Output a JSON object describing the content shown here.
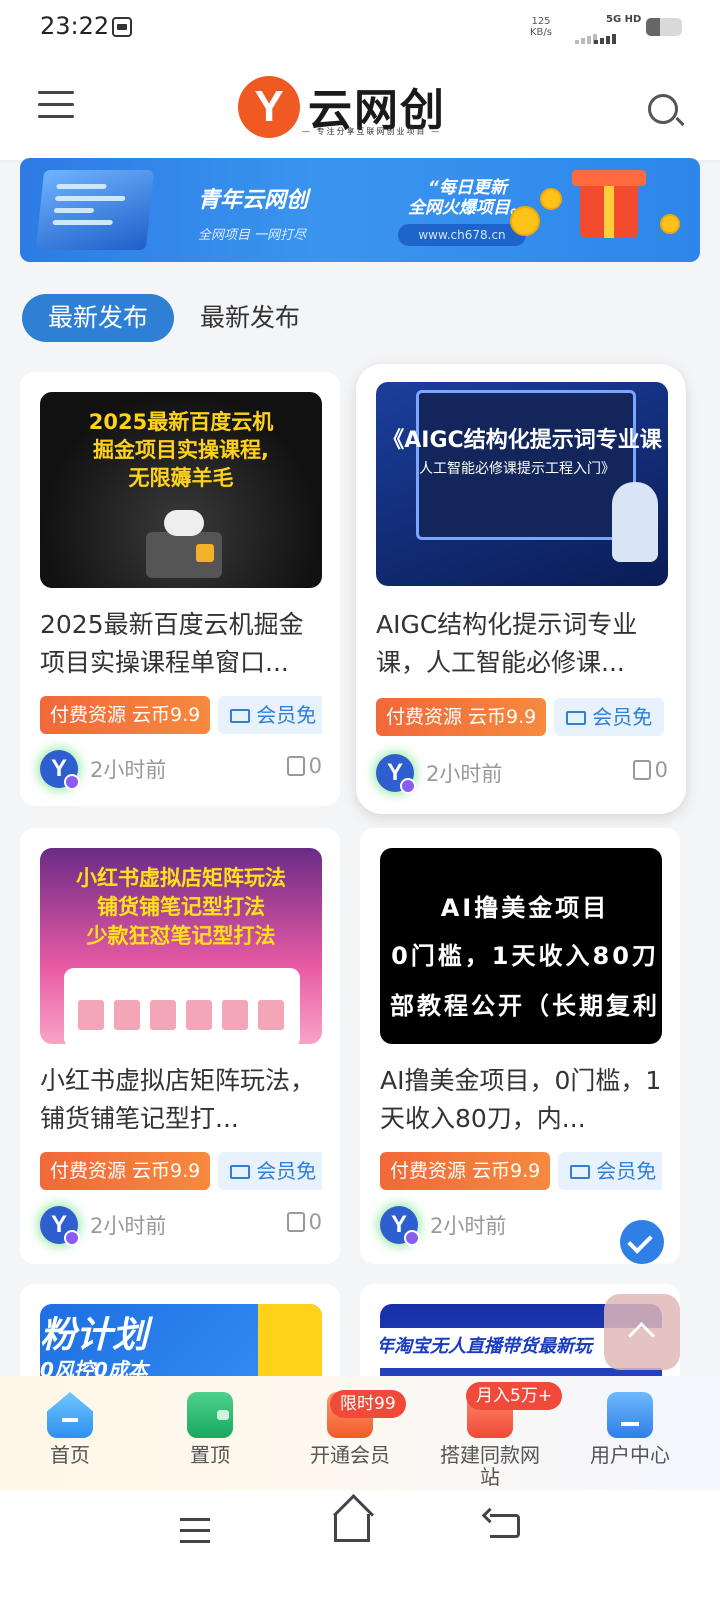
{
  "status_bar": {
    "time": "23:22",
    "speed_value": "125",
    "speed_unit": "KB/s",
    "network": "5G HD",
    "battery_level": 0.4
  },
  "header": {
    "logo_text": "云网创",
    "logo_badge": "Y",
    "logo_tagline": "— 专注分享互联网创业项目 —",
    "icons": [
      "menu-icon",
      "search-icon"
    ]
  },
  "banner": {
    "title": "青年云网创",
    "subtitle": "全网项目  一网打尽",
    "slogan_line1": "“每日更新",
    "slogan_line2": "全网火爆项目。",
    "url": "www.ch678.cn"
  },
  "tabs": [
    "最新发布",
    "最新发布"
  ],
  "posts": [
    {
      "thumb_lines": [
        "2025最新百度云机",
        "掘金项目实操课程,",
        "无限薅羊毛"
      ],
      "title": "2025最新百度云机掘金项目实操课程单窗口...",
      "tag_paid": "付费资源 云币9.9",
      "tag_vip": "会员免",
      "avatar": "Y",
      "time": "2小时前",
      "likes": "0"
    },
    {
      "thumb_lines": [
        "《AIGC结构化提示词专业课",
        "人工智能必修课提示工程入门》"
      ],
      "title": "AIGC结构化提示词专业课，人工智能必修课...",
      "tag_paid": "付费资源 云币9.9",
      "tag_vip": "会员免",
      "avatar": "Y",
      "time": "2小时前",
      "likes": "0"
    },
    {
      "thumb_lines": [
        "小红书虚拟店矩阵玩法",
        "铺货铺笔记型打法",
        "少款狂怼笔记型打法"
      ],
      "title": "小红书虚拟店矩阵玩法，铺货铺笔记型打...",
      "tag_paid": "付费资源 云币9.9",
      "tag_vip": "会员免",
      "avatar": "Y",
      "time": "2小时前",
      "likes": "0"
    },
    {
      "thumb_lines": [
        "AI撸美金项目",
        "0门槛，1天收入80刀",
        "部教程公开（长期复利"
      ],
      "title": "AI撸美金项目，0门槛，1天收入80刀，内...",
      "tag_paid": "付费资源 云币9.9",
      "tag_vip": "会员免",
      "avatar": "Y",
      "time": "2小时前",
      "likes": ""
    },
    {
      "thumb_lines": [
        "粉计划",
        "0风控0成本"
      ]
    },
    {
      "thumb_lines": [
        "年淘宝无人直播带货最新玩"
      ]
    }
  ],
  "bottom_nav": [
    {
      "label": "首页",
      "icon": "home-icon"
    },
    {
      "label": "置顶",
      "icon": "wallet-icon"
    },
    {
      "label": "开通会员",
      "icon": "vip-bag-icon",
      "badge": "限时99"
    },
    {
      "label": "搭建同款网站",
      "icon": "shop-icon",
      "badge": "月入5万+"
    },
    {
      "label": "用户中心",
      "icon": "user-icon"
    }
  ],
  "colors": {
    "accent": "#2f7fd4",
    "paid_tag": "#f2683a",
    "logo": "#f05a22"
  }
}
